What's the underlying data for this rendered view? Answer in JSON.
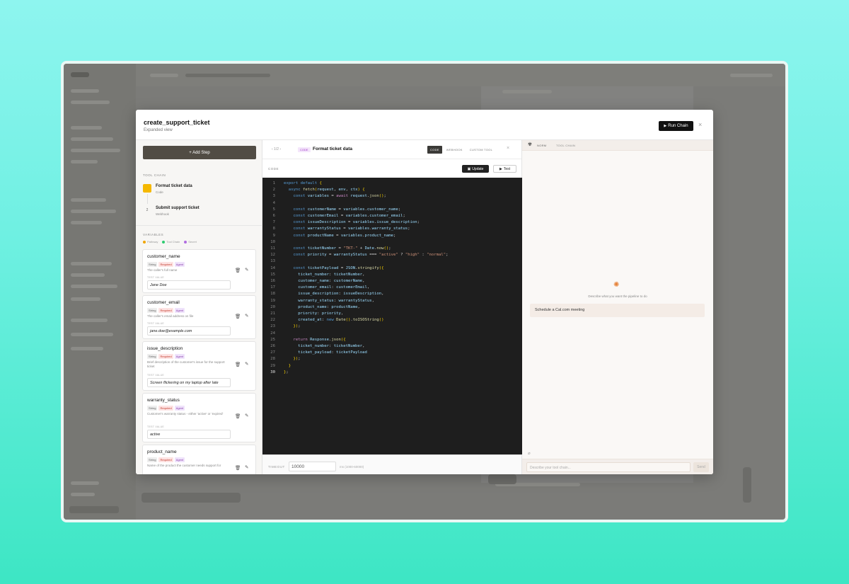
{
  "modal": {
    "title": "create_support_ticket",
    "subtitle": "Expanded view",
    "run_button": "Run Chain",
    "close_glyph": "×"
  },
  "left": {
    "add_step": "+ Add Step",
    "tool_chain_label": "TOOL CHAIN",
    "steps": [
      {
        "num": "1",
        "title": "Format ticket data",
        "type": "Code"
      },
      {
        "num": "2",
        "title": "Submit support ticket",
        "type": "Webhook"
      }
    ],
    "variables_label": "VARIABLES",
    "legend": [
      {
        "label": "Pathway",
        "color": "#f0a500"
      },
      {
        "label": "Tool Chain",
        "color": "#2ecc71"
      },
      {
        "label": "Secret",
        "color": "#b06ce0"
      }
    ],
    "test_value_label": "TEST VALUE",
    "tags": {
      "string": "String",
      "required": "Required",
      "agent": "Agent"
    },
    "variables": [
      {
        "name": "customer_name",
        "desc": "The caller's full name",
        "value": "Jane Doe"
      },
      {
        "name": "customer_email",
        "desc": "The caller's email address on file",
        "value": "jane.doe@example.com"
      },
      {
        "name": "issue_description",
        "desc": "Brief description of the customer's issue for the support ticket",
        "value": "Screen flickering on my laptop after late"
      },
      {
        "name": "warranty_status",
        "desc": "Customer's warranty status - either 'active' or 'expired'",
        "value": "active"
      },
      {
        "name": "product_name",
        "desc": "Name of the product the customer needs support for",
        "value": ""
      }
    ]
  },
  "mid": {
    "pager": "‹  1/2  ›",
    "code_pill": "CODE",
    "title": "Format ticket data",
    "tabs": [
      "CODE",
      "WEBHOOK",
      "CUSTOM TOOL"
    ],
    "active_tab": "CODE",
    "close_glyph": "×",
    "code_label": "CODE",
    "update_button": "Update",
    "test_button": "Test",
    "timeout_label": "TIMEOUT",
    "timeout_value": "10000",
    "timeout_hint": "ms (1000-60000)"
  },
  "code_lines": [
    [
      [
        "kw",
        "export "
      ],
      [
        "kw",
        "default "
      ],
      [
        "br",
        "{"
      ]
    ],
    [
      [
        "pl",
        "  "
      ],
      [
        "kw",
        "async "
      ],
      [
        "fn",
        "fetch"
      ],
      [
        "br",
        "("
      ],
      [
        "id",
        "request"
      ],
      [
        "pl",
        ", "
      ],
      [
        "id",
        "env"
      ],
      [
        "pl",
        ", "
      ],
      [
        "id",
        "ctx"
      ],
      [
        "br",
        ") {"
      ]
    ],
    [
      [
        "pl",
        "    "
      ],
      [
        "kw",
        "const "
      ],
      [
        "id",
        "variables"
      ],
      [
        "pl",
        " = "
      ],
      [
        "kw2",
        "await "
      ],
      [
        "id",
        "request"
      ],
      [
        "pl",
        "."
      ],
      [
        "fn",
        "json"
      ],
      [
        "br",
        "()"
      ],
      [
        "pl",
        ";"
      ]
    ],
    [],
    [
      [
        "pl",
        "    "
      ],
      [
        "kw",
        "const "
      ],
      [
        "id",
        "customerName"
      ],
      [
        "pl",
        " = "
      ],
      [
        "id",
        "variables"
      ],
      [
        "pl",
        "."
      ],
      [
        "id",
        "customer_name"
      ],
      [
        "pl",
        ";"
      ]
    ],
    [
      [
        "pl",
        "    "
      ],
      [
        "kw",
        "const "
      ],
      [
        "id",
        "customerEmail"
      ],
      [
        "pl",
        " = "
      ],
      [
        "id",
        "variables"
      ],
      [
        "pl",
        "."
      ],
      [
        "id",
        "customer_email"
      ],
      [
        "pl",
        ";"
      ]
    ],
    [
      [
        "pl",
        "    "
      ],
      [
        "kw",
        "const "
      ],
      [
        "id",
        "issueDescription"
      ],
      [
        "pl",
        " = "
      ],
      [
        "id",
        "variables"
      ],
      [
        "pl",
        "."
      ],
      [
        "id",
        "issue_description"
      ],
      [
        "pl",
        ";"
      ]
    ],
    [
      [
        "pl",
        "    "
      ],
      [
        "kw",
        "const "
      ],
      [
        "id",
        "warrantyStatus"
      ],
      [
        "pl",
        " = "
      ],
      [
        "id",
        "variables"
      ],
      [
        "pl",
        "."
      ],
      [
        "id",
        "warranty_status"
      ],
      [
        "pl",
        ";"
      ]
    ],
    [
      [
        "pl",
        "    "
      ],
      [
        "kw",
        "const "
      ],
      [
        "id",
        "productName"
      ],
      [
        "pl",
        " = "
      ],
      [
        "id",
        "variables"
      ],
      [
        "pl",
        "."
      ],
      [
        "id",
        "product_name"
      ],
      [
        "pl",
        ";"
      ]
    ],
    [],
    [
      [
        "pl",
        "    "
      ],
      [
        "kw",
        "const "
      ],
      [
        "id",
        "ticketNumber"
      ],
      [
        "pl",
        " = "
      ],
      [
        "str",
        "\"TKT-\""
      ],
      [
        "pl",
        " + "
      ],
      [
        "id",
        "Date"
      ],
      [
        "pl",
        "."
      ],
      [
        "fn",
        "now"
      ],
      [
        "br",
        "()"
      ],
      [
        "pl",
        ";"
      ]
    ],
    [
      [
        "pl",
        "    "
      ],
      [
        "kw",
        "const "
      ],
      [
        "id",
        "priority"
      ],
      [
        "pl",
        " = "
      ],
      [
        "id",
        "warrantyStatus"
      ],
      [
        "pl",
        " === "
      ],
      [
        "str",
        "\"active\""
      ],
      [
        "pl",
        " ? "
      ],
      [
        "str",
        "\"high\""
      ],
      [
        "pl",
        " : "
      ],
      [
        "str",
        "\"normal\""
      ],
      [
        "pl",
        ";"
      ]
    ],
    [],
    [
      [
        "pl",
        "    "
      ],
      [
        "kw",
        "const "
      ],
      [
        "id",
        "ticketPayload"
      ],
      [
        "pl",
        " = "
      ],
      [
        "id",
        "JSON"
      ],
      [
        "pl",
        "."
      ],
      [
        "fn",
        "stringify"
      ],
      [
        "br",
        "({"
      ]
    ],
    [
      [
        "pl",
        "      "
      ],
      [
        "id",
        "ticket_number"
      ],
      [
        "pl",
        ": "
      ],
      [
        "id",
        "ticketNumber"
      ],
      [
        "pl",
        ","
      ]
    ],
    [
      [
        "pl",
        "      "
      ],
      [
        "id",
        "customer_name"
      ],
      [
        "pl",
        ": "
      ],
      [
        "id",
        "customerName"
      ],
      [
        "pl",
        ","
      ]
    ],
    [
      [
        "pl",
        "      "
      ],
      [
        "id",
        "customer_email"
      ],
      [
        "pl",
        ": "
      ],
      [
        "id",
        "customerEmail"
      ],
      [
        "pl",
        ","
      ]
    ],
    [
      [
        "pl",
        "      "
      ],
      [
        "id",
        "issue_description"
      ],
      [
        "pl",
        ": "
      ],
      [
        "id",
        "issueDescription"
      ],
      [
        "pl",
        ","
      ]
    ],
    [
      [
        "pl",
        "      "
      ],
      [
        "id",
        "warranty_status"
      ],
      [
        "pl",
        ": "
      ],
      [
        "id",
        "warrantyStatus"
      ],
      [
        "pl",
        ","
      ]
    ],
    [
      [
        "pl",
        "      "
      ],
      [
        "id",
        "product_name"
      ],
      [
        "pl",
        ": "
      ],
      [
        "id",
        "productName"
      ],
      [
        "pl",
        ","
      ]
    ],
    [
      [
        "pl",
        "      "
      ],
      [
        "id",
        "priority"
      ],
      [
        "pl",
        ": "
      ],
      [
        "id",
        "priority"
      ],
      [
        "pl",
        ","
      ]
    ],
    [
      [
        "pl",
        "      "
      ],
      [
        "id",
        "created_at"
      ],
      [
        "pl",
        ": "
      ],
      [
        "kw",
        "new "
      ],
      [
        "fn",
        "Date"
      ],
      [
        "br",
        "()"
      ],
      [
        "pl",
        "."
      ],
      [
        "fn",
        "toISOString"
      ],
      [
        "br",
        "()"
      ]
    ],
    [
      [
        "pl",
        "    "
      ],
      [
        "br",
        "})"
      ],
      [
        "pl",
        ";"
      ]
    ],
    [],
    [
      [
        "pl",
        "    "
      ],
      [
        "kw2",
        "return "
      ],
      [
        "id",
        "Response"
      ],
      [
        "pl",
        "."
      ],
      [
        "fn",
        "json"
      ],
      [
        "br",
        "({"
      ]
    ],
    [
      [
        "pl",
        "      "
      ],
      [
        "id",
        "ticket_number"
      ],
      [
        "pl",
        ": "
      ],
      [
        "id",
        "ticketNumber"
      ],
      [
        "pl",
        ","
      ]
    ],
    [
      [
        "pl",
        "      "
      ],
      [
        "id",
        "ticket_payload"
      ],
      [
        "pl",
        ": "
      ],
      [
        "id",
        "ticketPayload"
      ]
    ],
    [
      [
        "pl",
        "    "
      ],
      [
        "br",
        "})"
      ],
      [
        "pl",
        ";"
      ]
    ],
    [
      [
        "pl",
        "  "
      ],
      [
        "br",
        "}"
      ]
    ],
    [
      [
        "br",
        "}"
      ],
      [
        "pl",
        ";"
      ]
    ]
  ],
  "right": {
    "crumb1": "NORM",
    "crumb2": "TOOL CHAIN",
    "describe": "Describe what you want the pipeline to do",
    "suggestion": "Schedule a Cal.com meeting",
    "input_placeholder": "Describe your tool chain...",
    "send": "Send"
  },
  "colors": {
    "accent_step": "#f5b800",
    "editor_bg": "#1e1e1e",
    "add_step_bg": "#514c44"
  }
}
